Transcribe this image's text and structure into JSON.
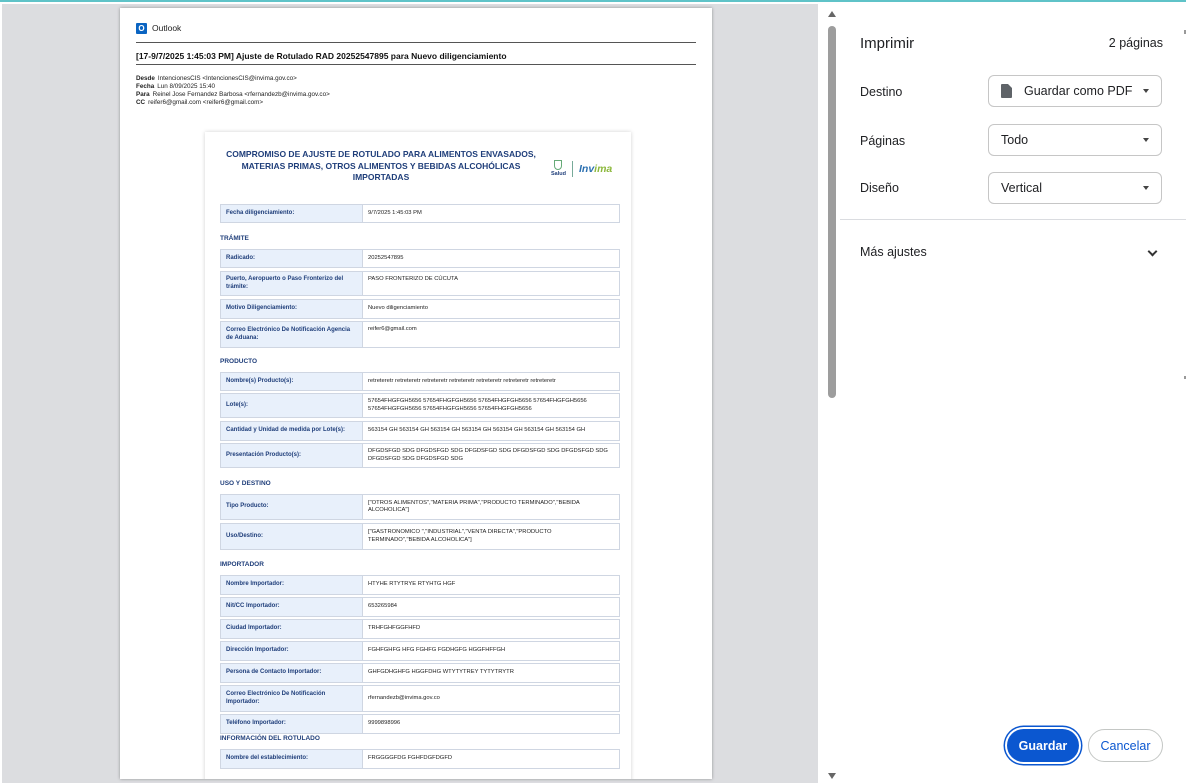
{
  "outlook": {
    "app_name": "Outlook",
    "logo_letter": "O"
  },
  "email": {
    "subject": "[17-9/7/2025 1:45:03 PM] Ajuste de Rotulado RAD 20252547895 para Nuevo diligenciamiento",
    "from_label": "Desde",
    "from": "IntencionesCIS <IntencionesCIS@invima.gov.co>",
    "date_label": "Fecha",
    "date": "Lun 8/09/2025 15:40",
    "to_label": "Para",
    "to": "Reinel Jose Fernandez Barbosa <rfernandezb@invima.gov.co>",
    "cc_label": "CC",
    "cc": "reifer6@gmail.com <reifer6@gmail.com>"
  },
  "form": {
    "title": "COMPROMISO DE AJUSTE DE ROTULADO PARA ALIMENTOS ENVASADOS, MATERIAS PRIMAS, OTROS ALIMENTOS Y BEBIDAS ALCOHÓLICAS IMPORTADAS",
    "logo_salud": "Salud",
    "logo_invima_a": "Inv",
    "logo_invima_b": "ima",
    "fecha": {
      "label": "Fecha diligenciamiento:",
      "value": "9/7/2025 1:45:03 PM"
    },
    "sections": {
      "tramite": "TRÁMITE",
      "producto": "PRODUCTO",
      "uso": "USO Y DESTINO",
      "importador": "IMPORTADOR",
      "rotulado": "INFORMACIÓN DEL ROTULADO"
    },
    "rows": [
      {
        "label": "Radicado:",
        "value": "20252547895"
      },
      {
        "label": "Puerto, Aeropuerto o Paso Fronterizo del trámite:",
        "value": "PASO FRONTERIZO DE CÚCUTA"
      },
      {
        "label": "Motivo Diligenciamiento:",
        "value": "Nuevo diligenciamiento"
      },
      {
        "label": "Correo Electrónico De Notificación Agencia de Aduana:",
        "value": "reifer6@gmail.com"
      },
      {
        "label": "Nombre(s) Producto(s):",
        "value": "retreteretr retreteretr retreteretr retreteretr retreteretr retreteretr retreteretr"
      },
      {
        "label": "Lote(s):",
        "value": "57654FHGFGH5656 57654FHGFGH5656 57654FHGFGH5656 57654FHGFGH5656 57654FHGFGH5656 57654FHGFGH5656 57654FHGFGH5656"
      },
      {
        "label": "Cantidad y Unidad de medida por Lote(s):",
        "value": "563154 GH 563154 GH 563154 GH 563154 GH 563154 GH 563154 GH 563154 GH"
      },
      {
        "label": "Presentación Producto(s):",
        "value": "DFGDSFGD SDG DFGDSFGD SDG DFGDSFGD SDG DFGDSFGD SDG DFGDSFGD SDG DFGDSFGD SDG DFGDSFGD SDG"
      },
      {
        "label": "Tipo Producto:",
        "value": "[\"OTROS ALIMENTOS\",\"MATERIA PRIMA\",\"PRODUCTO TERMINADO\",\"BEBIDA ALCOHOLICA\"]"
      },
      {
        "label": "Uso/Destino:",
        "value": "[\"GASTRONOMICO \",\"INDUSTRIAL\",\"VENTA DIRECTA\",\"PRODUCTO TERMINADO\",\"BEBIDA ALCOHOLICA\"]"
      },
      {
        "label": "Nombre Importador:",
        "value": "HTYHE RTYTRYE RTYHTG HGF"
      },
      {
        "label": "Nit/CC Importador:",
        "value": "653265984"
      },
      {
        "label": "Ciudad Importador:",
        "value": "TRHFGHFGGFHFD"
      },
      {
        "label": "Dirección Importador:",
        "value": "FGHFGHFG HFG FGHFG FGDHGFG HGGFHFFGH"
      },
      {
        "label": "Persona de Contacto Importador:",
        "value": "GHFGDHGHFG HGGFDHG WTYTYTREY TYTYTRYTR"
      },
      {
        "label": "Correo Electrónico De Notificación Importador:",
        "value": "rfernandezb@invima.gov.co"
      },
      {
        "label": "Teléfono Importador:",
        "value": "9999898996"
      },
      {
        "label": "Nombre del establecimiento:",
        "value": "FRGGGGFDG FGHFDGFDGFD"
      }
    ]
  },
  "print": {
    "title": "Imprimir",
    "pages_count": "2 páginas",
    "destino_label": "Destino",
    "destino_value": "Guardar como PDF",
    "paginas_label": "Páginas",
    "paginas_value": "Todo",
    "diseno_label": "Diseño",
    "diseno_value": "Vertical",
    "more_settings": "Más ajustes",
    "save_button": "Guardar",
    "cancel_button": "Cancelar"
  }
}
